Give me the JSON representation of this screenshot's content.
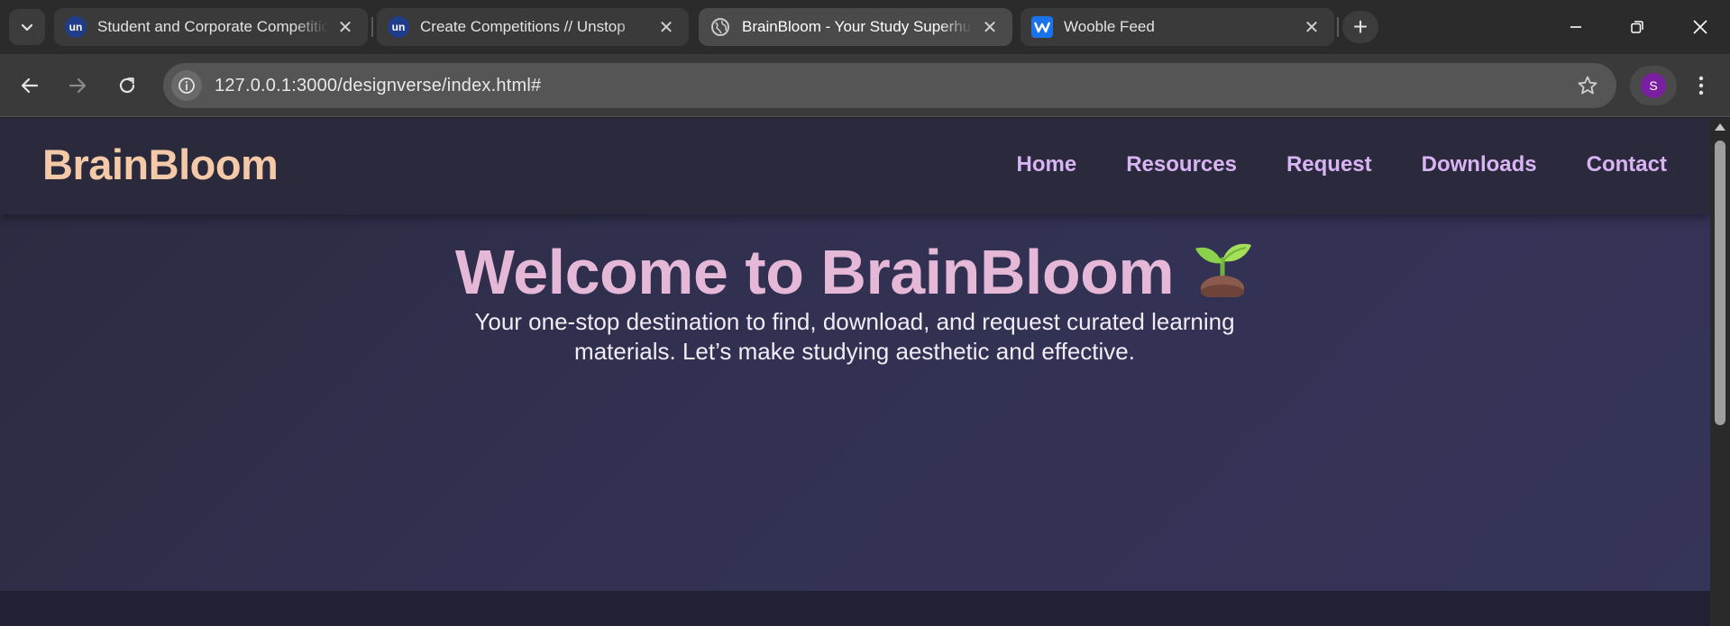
{
  "browser": {
    "tabs": [
      {
        "title": "Student and Corporate Competitions",
        "favicon": "un",
        "active": false
      },
      {
        "title": "Create Competitions // Unstop",
        "favicon": "un",
        "active": false
      },
      {
        "title": "BrainBloom - Your Study Superhub",
        "favicon": "globe-icon",
        "active": true
      },
      {
        "title": "Wooble Feed",
        "favicon": "wooble-icon",
        "active": false
      }
    ],
    "close_glyph": "✕",
    "new_tab_glyph": "+",
    "url": "127.0.0.1:3000/designverse/index.html#",
    "profile_initial": "S",
    "profile_color": "#7b1fa2"
  },
  "site": {
    "logo": "BrainBloom",
    "nav": [
      "Home",
      "Resources",
      "Request",
      "Downloads",
      "Contact"
    ],
    "hero": {
      "title": "Welcome to BrainBloom",
      "emoji_icon": "seedling-icon",
      "subtitle": "Your one-stop destination to find, download, and request curated learning materials. Let’s make studying aesthetic and effective."
    },
    "colors": {
      "logo": "#f3c9a8",
      "nav": "#d8b4f5",
      "hero_title": "#e6b8d8",
      "hero_bg": "#323152",
      "header_bg": "#2b2a3d"
    }
  }
}
